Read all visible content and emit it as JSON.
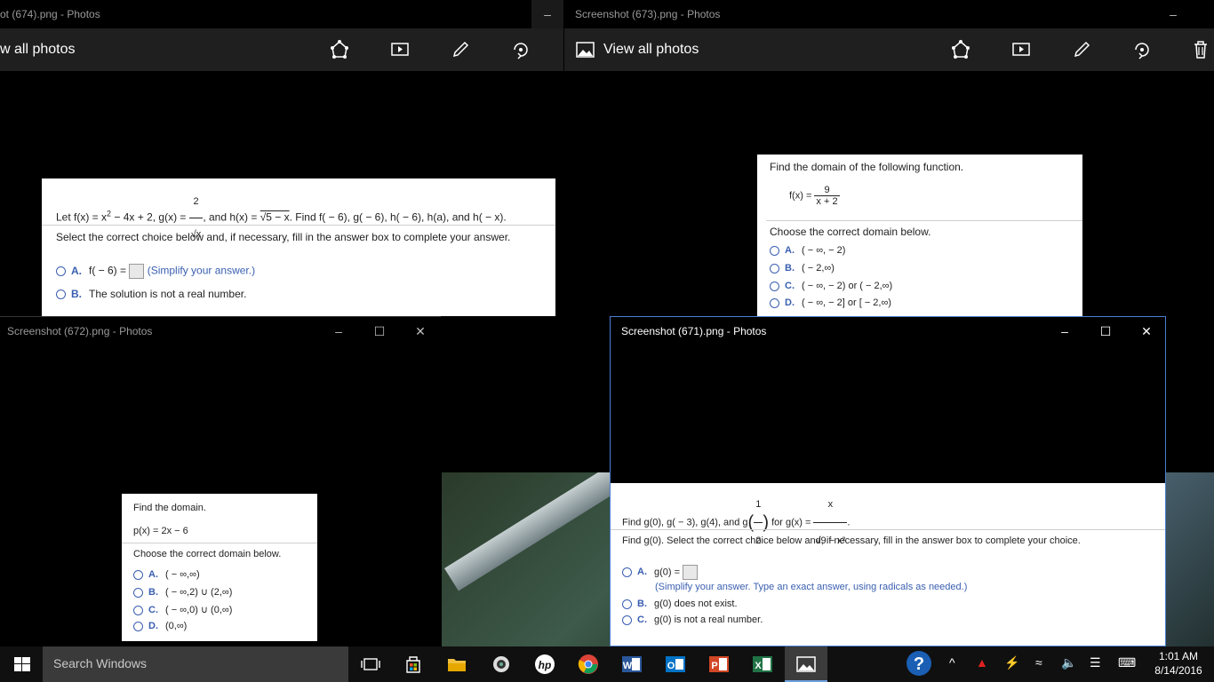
{
  "windows": {
    "w674": {
      "title": "ot (674).png - Photos",
      "view_all": "w all photos",
      "minimize": "–"
    },
    "w673": {
      "title": "Screenshot (673).png - Photos",
      "view_all": "View all photos",
      "minimize": "–"
    },
    "w672": {
      "title": "Screenshot (672).png - Photos",
      "minimize": "–",
      "maximize": "☐",
      "close": "✕"
    },
    "w671": {
      "title": "Screenshot (671).png - Photos",
      "minimize": "–",
      "maximize": "☐",
      "close": "✕"
    }
  },
  "q674": {
    "prompt_pre": "Let f(x) = x",
    "prompt_sup": "2",
    "prompt_mid": " − 4x + 2,  g(x) = ",
    "frac_num": "2",
    "frac_den": "√x",
    "prompt_mid2": ", and h(x) = ",
    "sqrt_expr": "√5 − x",
    "prompt_post": ". Find f( − 6), g( − 6), h( − 6), h(a), and h( − x).",
    "instruction": "Select the correct choice below and, if necessary, fill in the answer box to complete your answer.",
    "optA_letter": "A.",
    "optA_text": "f( − 6) = ",
    "optA_hint": "(Simplify your answer.)",
    "optB_letter": "B.",
    "optB_text": "The solution is not a real number."
  },
  "q673": {
    "prompt": "Find the domain of the following function.",
    "fx_label": "f(x) = ",
    "frac_num": "9",
    "frac_den": "x + 2",
    "instruction": "Choose the correct domain below.",
    "options": [
      {
        "letter": "A.",
        "text": "( − ∞, − 2)"
      },
      {
        "letter": "B.",
        "text": "( − 2,∞)"
      },
      {
        "letter": "C.",
        "text": "( − ∞, − 2) or ( − 2,∞)"
      },
      {
        "letter": "D.",
        "text": "( − ∞, − 2] or [ − 2,∞)"
      }
    ]
  },
  "q672": {
    "prompt": "Find the domain.",
    "function": "p(x) = 2x − 6",
    "instruction": "Choose the correct domain below.",
    "options": [
      {
        "letter": "A.",
        "text": "( − ∞,∞)"
      },
      {
        "letter": "B.",
        "text": "( − ∞,2) ∪ (2,∞)"
      },
      {
        "letter": "C.",
        "text": "( − ∞,0) ∪ (0,∞)"
      },
      {
        "letter": "D.",
        "text": "(0,∞)"
      }
    ]
  },
  "q671": {
    "prompt_pre": "Find g(0), g( − 3), g(4), and g",
    "half_num": "1",
    "half_den": "2",
    "prompt_mid": " for g(x) = ",
    "frac_num": "x",
    "frac_den": "√9 − x²",
    "instruction": "Find g(0). Select the correct choice below and, if necessary, fill in the answer box to complete your choice.",
    "optA_letter": "A.",
    "optA_text": "g(0) = ",
    "optA_hint": "(Simplify your answer. Type an exact answer, using radicals as needed.)",
    "optB_letter": "B.",
    "optB_text": "g(0) does not exist.",
    "optC_letter": "C.",
    "optC_text": "g(0) is not a real number."
  },
  "taskbar": {
    "search_placeholder": "Search Windows",
    "time": "1:01 AM",
    "date": "8/14/2016"
  },
  "colors": {
    "accent": "#3a5fb0",
    "taskbar": "#101010",
    "appbar": "#1f1f1f"
  }
}
